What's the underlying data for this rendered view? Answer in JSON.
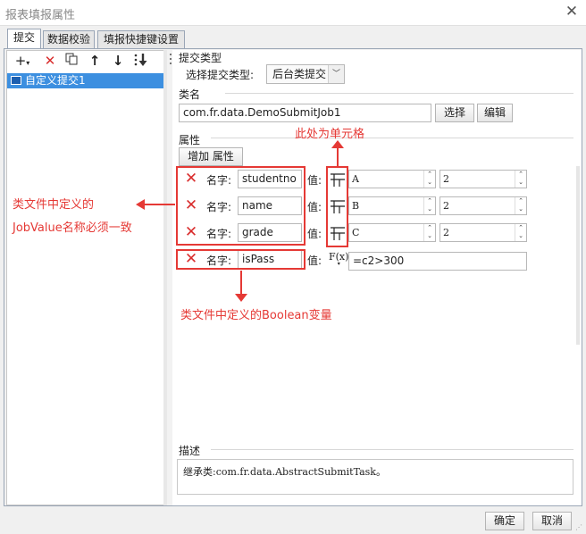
{
  "window": {
    "title": "报表填报属性"
  },
  "tabs": [
    {
      "label": "提交",
      "active": true
    },
    {
      "label": "数据校验",
      "active": false
    },
    {
      "label": "填报快捷键设置",
      "active": false
    }
  ],
  "left": {
    "toolbar": [
      "add-dropdown",
      "delete",
      "copy",
      "move-up",
      "move-down",
      "move-bottom"
    ],
    "items": [
      {
        "label": "自定义提交1",
        "selected": true
      }
    ]
  },
  "submit_type": {
    "section": "提交类型",
    "label": "选择提交类型:",
    "value": "后台类提交"
  },
  "class_name": {
    "section": "类名",
    "value": "com.fr.data.DemoSubmitJob1",
    "select_button": "选择",
    "edit_button": "编辑"
  },
  "attributes": {
    "section": "属性",
    "add_button": "增加 属性",
    "name_label": "名字:",
    "value_label": "值:",
    "rows": [
      {
        "name": "studentno",
        "value_type": "cell",
        "value": "A",
        "number": "2"
      },
      {
        "name": "name",
        "value_type": "cell",
        "value": "B",
        "number": "2"
      },
      {
        "name": "grade",
        "value_type": "cell",
        "value": "C",
        "number": "2"
      },
      {
        "name": "isPass",
        "value_type": "formula",
        "formula_icon": "F(x)",
        "value": "=c2>300"
      }
    ]
  },
  "annotations": {
    "cell_note": "此处为单元格",
    "jobvalue_note_1": "类文件中定义的",
    "jobvalue_note_2": "JobValue名称必须一致",
    "boolean_note": "类文件中定义的Boolean变量"
  },
  "description": {
    "section": "描述",
    "text": "继承类:com.fr.data.AbstractSubmitTask。"
  },
  "footer": {
    "ok": "确定",
    "cancel": "取消"
  },
  "colors": {
    "annotation": "#e53935",
    "selection": "#3c8fe0",
    "delete": "#d92d2d"
  }
}
